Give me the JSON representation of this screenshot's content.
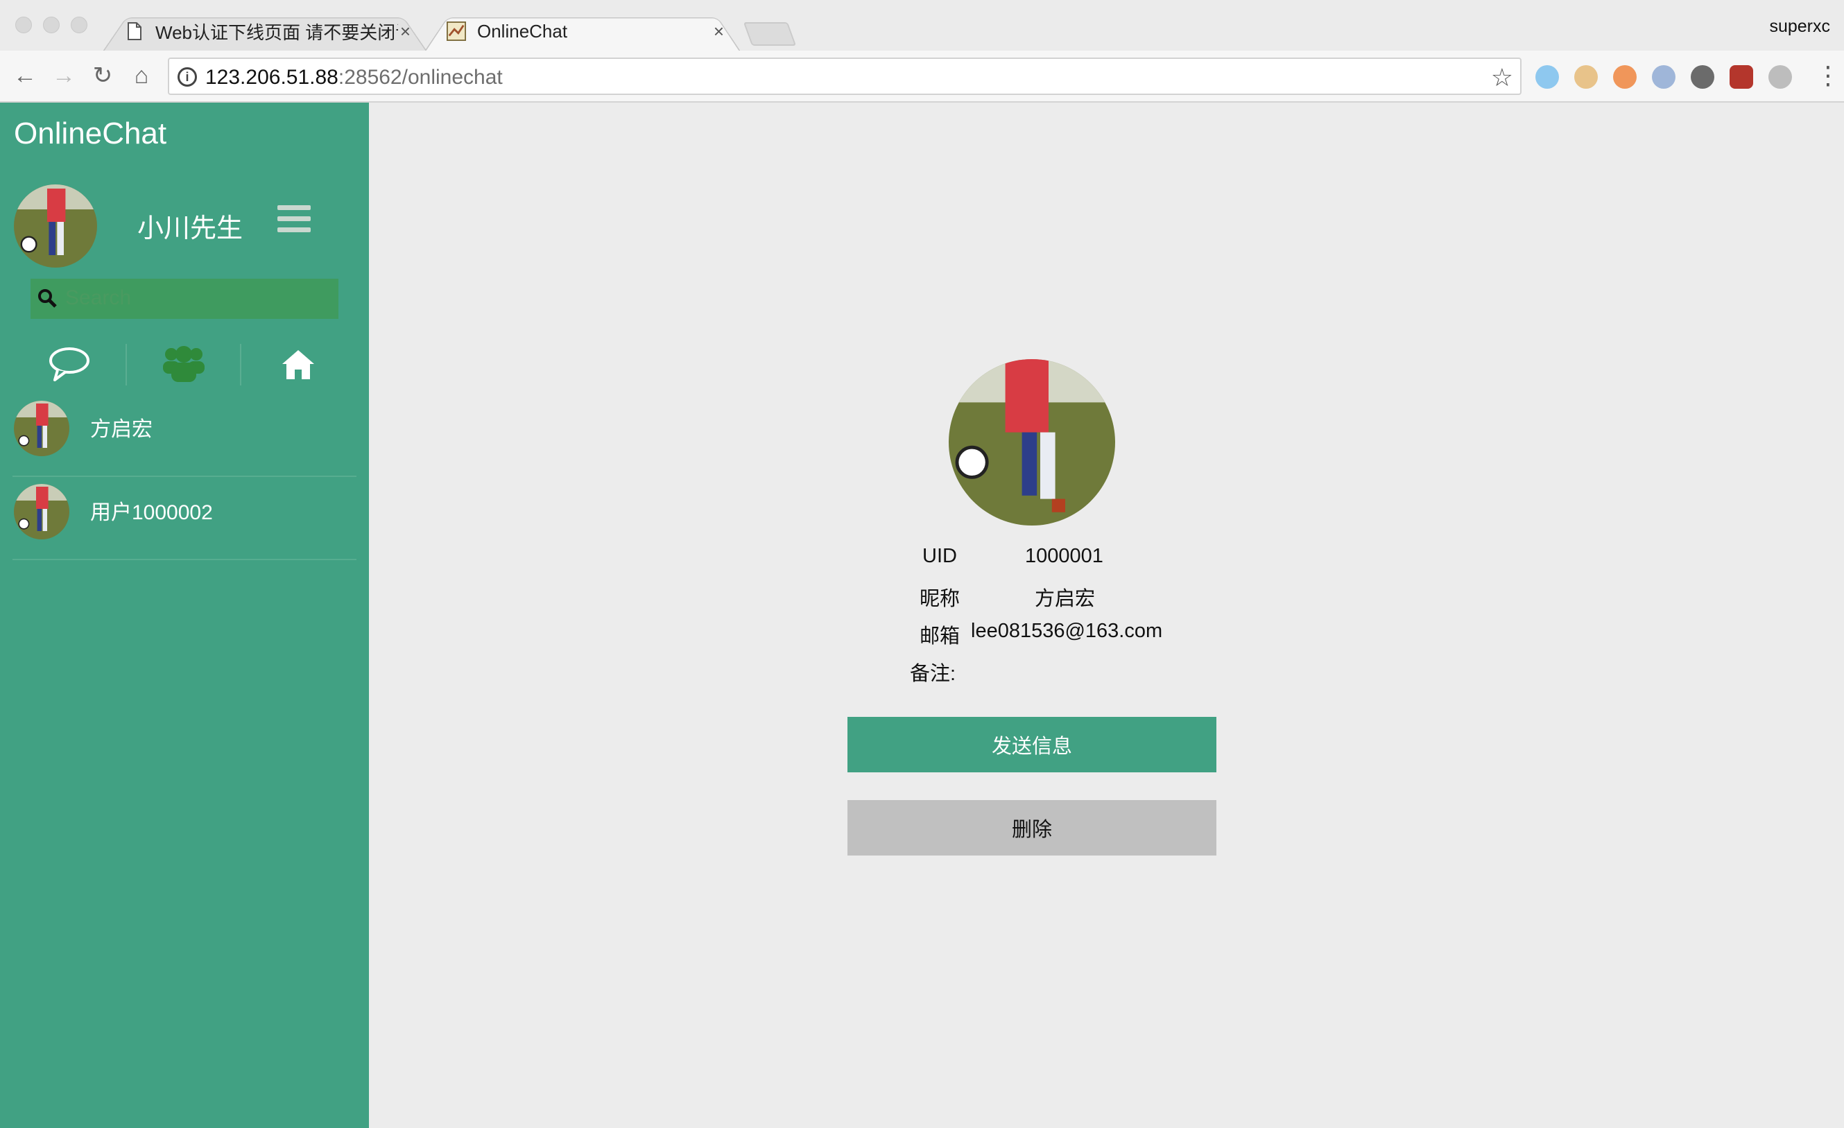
{
  "browser": {
    "tabs": [
      {
        "title": "Web认证下线页面 请不要关闭该",
        "active": false
      },
      {
        "title": "OnlineChat",
        "active": true
      }
    ],
    "close_glyph": "×",
    "profile_name": "superxc",
    "url_host": "123.206.51.88",
    "url_path": ":28562/onlinechat",
    "nav": {
      "back": "←",
      "forward": "→",
      "reload": "↻",
      "home": "⌂"
    },
    "star_glyph": "☆",
    "menu_glyph": "⋮",
    "info_glyph": "i"
  },
  "app": {
    "title": "OnlineChat",
    "user_name": "小川先生",
    "search_placeholder": "Search",
    "contacts": [
      {
        "name": "方启宏"
      },
      {
        "name": "用户1000002"
      }
    ]
  },
  "profile": {
    "uid_label": "UID",
    "uid_value": "1000001",
    "nickname_label": "昵称",
    "nickname_value": "方启宏",
    "email_label": "邮箱",
    "email_value": "lee081536@163.com",
    "remark_label": "备注:",
    "send_label": "发送信息",
    "delete_label": "删除"
  },
  "colors": {
    "sidebar": "#41a183",
    "search_bg": "#3f9b5f",
    "send_button": "#41a183",
    "delete_button": "#c0c0c0",
    "group_icon": "#2f8a3a"
  }
}
